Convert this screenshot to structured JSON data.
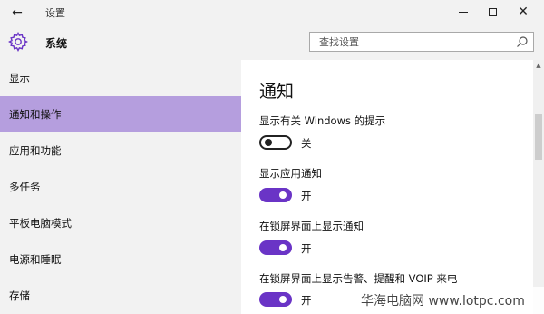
{
  "window": {
    "title": "设置",
    "back_icon": "back-arrow-icon",
    "minimize_icon": "minimize-icon",
    "maximize_icon": "maximize-icon",
    "close_icon": "close-icon"
  },
  "header": {
    "section_icon": "gear-icon",
    "section_title": "系统",
    "search": {
      "placeholder": "查找设置",
      "value": "",
      "icon": "search-icon"
    }
  },
  "sidebar": {
    "items": [
      {
        "label": "显示",
        "active": false
      },
      {
        "label": "通知和操作",
        "active": true
      },
      {
        "label": "应用和功能",
        "active": false
      },
      {
        "label": "多任务",
        "active": false
      },
      {
        "label": "平板电脑模式",
        "active": false
      },
      {
        "label": "电源和睡眠",
        "active": false
      },
      {
        "label": "存储",
        "active": false
      }
    ]
  },
  "content": {
    "title": "通知",
    "settings": [
      {
        "label": "显示有关 Windows 的提示",
        "state": "off",
        "state_label": "关"
      },
      {
        "label": "显示应用通知",
        "state": "on",
        "state_label": "开"
      },
      {
        "label": "在锁屏界面上显示通知",
        "state": "on",
        "state_label": "开"
      },
      {
        "label": "在锁屏界面上显示告警、提醒和 VOIP 来电",
        "state": "on",
        "state_label": "开"
      }
    ]
  },
  "colors": {
    "accent": "#6a34c6",
    "active_nav": "#b59ede",
    "chrome": "#f2f2f2"
  },
  "watermark": {
    "text": "华海电脑网 www.lotpc.com"
  }
}
